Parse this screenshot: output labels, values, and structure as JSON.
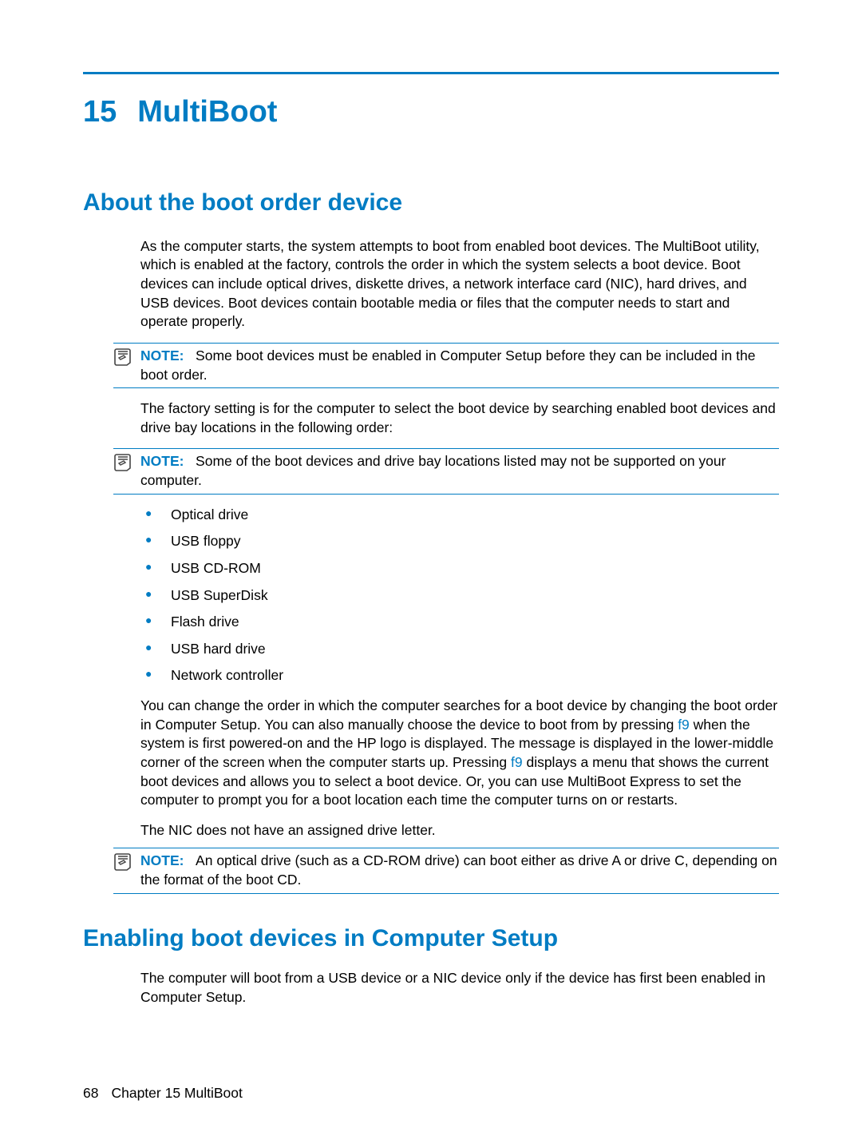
{
  "chapter": {
    "number": "15",
    "title": "MultiBoot"
  },
  "section1": {
    "title": "About the boot order device"
  },
  "para1": "As the computer starts, the system attempts to boot from enabled boot devices. The MultiBoot utility, which is enabled at the factory, controls the order in which the system selects a boot device. Boot devices can include optical drives, diskette drives, a network interface card (NIC), hard drives, and USB devices. Boot devices contain bootable media or files that the computer needs to start and operate properly.",
  "note_label": "NOTE:",
  "note1_text": "Some boot devices must be enabled in Computer Setup before they can be included in the boot order.",
  "para2": "The factory setting is for the computer to select the boot device by searching enabled boot devices and drive bay locations in the following order:",
  "note2_text": "Some of the boot devices and drive bay locations listed may not be supported on your computer.",
  "list_items": {
    "0": "Optical drive",
    "1": "USB floppy",
    "2": "USB CD-ROM",
    "3": "USB SuperDisk",
    "4": "Flash drive",
    "5": "USB hard drive",
    "6": "Network controller"
  },
  "para3a": "You can change the order in which the computer searches for a boot device by changing the boot order in Computer Setup. You can also manually choose the device to boot from by pressing ",
  "para3_f9a": "f9",
  "para3b": " when the system is first powered-on and the HP logo is displayed. The message is displayed in the lower-middle corner of the screen when the computer starts up. Pressing ",
  "para3_f9b": "f9",
  "para3c": " displays a menu that shows the current boot devices and allows you to select a boot device. Or, you can use MultiBoot Express to set the computer to prompt you for a boot location each time the computer turns on or restarts.",
  "para4": "The NIC does not have an assigned drive letter.",
  "note3_text": "An optical drive (such as a CD-ROM drive) can boot either as drive A or drive C, depending on the format of the boot CD.",
  "section2": {
    "title": "Enabling boot devices in Computer Setup"
  },
  "para5": "The computer will boot from a USB device or a NIC device only if the device has first been enabled in Computer Setup.",
  "footer": {
    "page": "68",
    "text": "Chapter 15   MultiBoot"
  }
}
